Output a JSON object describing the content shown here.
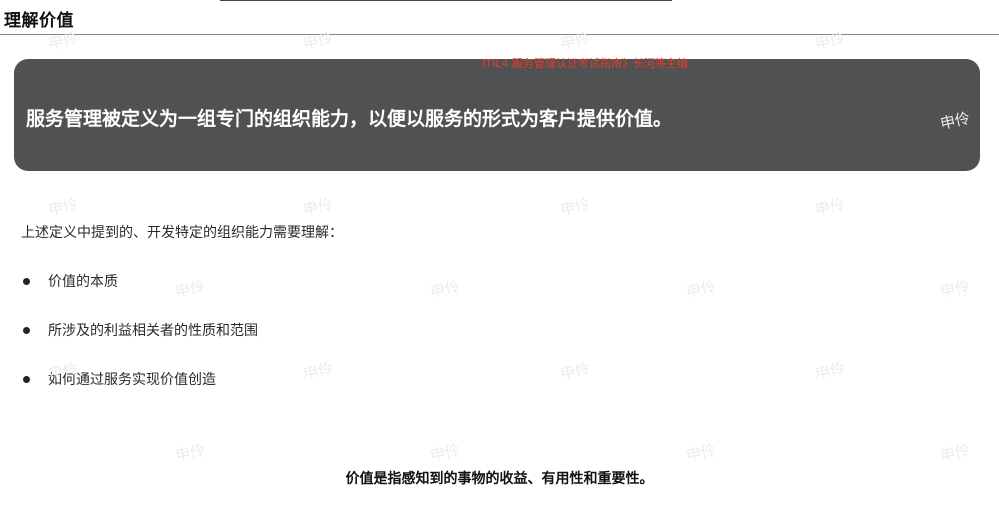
{
  "page": {
    "title": "理解价值",
    "source_note": "ITIL4 服务管理认证考试指南》长河等主编",
    "definition": "服务管理被定义为一组专门的组织能力，以便以服务的形式为客户提供价值。",
    "intro": "上述定义中提到的、开发特定的组织能力需要理解：",
    "bullets": [
      {
        "label": "价值的本质"
      },
      {
        "label": "所涉及的利益相关者的性质和范围"
      },
      {
        "label": "如何通过服务实现价值创造"
      }
    ],
    "statement": "价值是指感知到的事物的收益、有用性和重要性。"
  },
  "watermark": {
    "text": "申伶"
  },
  "colors": {
    "banner": "#505152",
    "source_note": "#e23b2e",
    "watermark": "#ececec"
  }
}
